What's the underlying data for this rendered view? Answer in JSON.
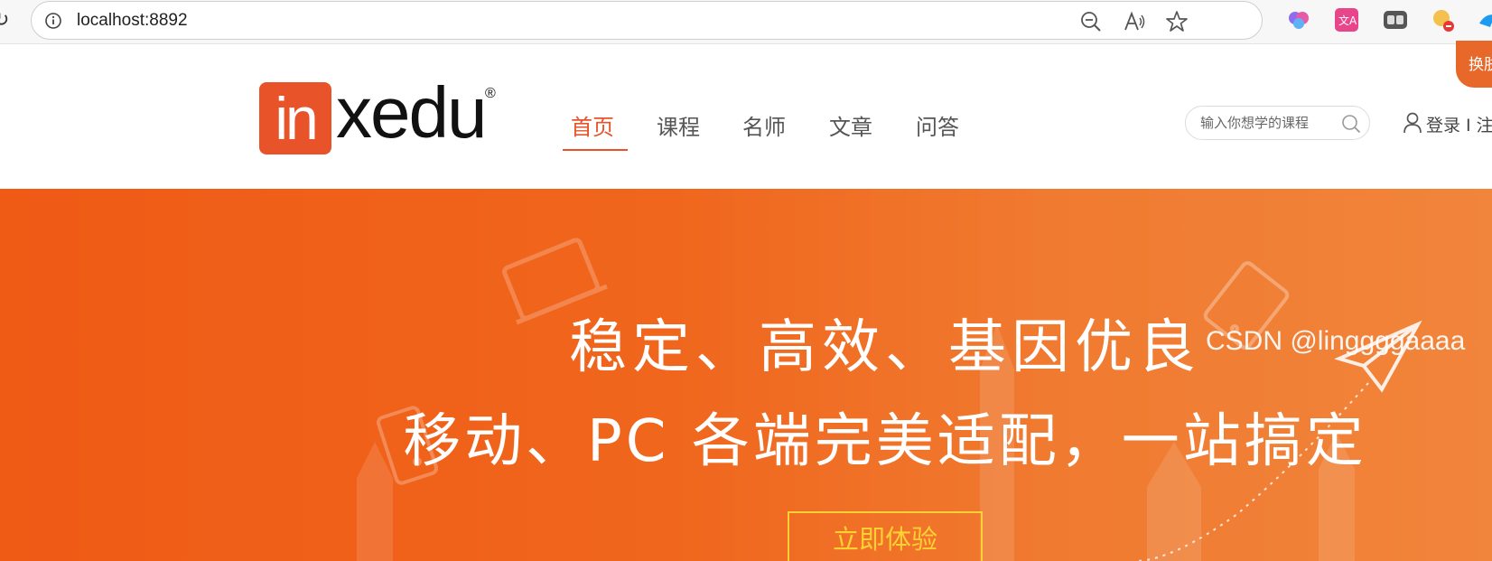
{
  "browser": {
    "url": "localhost:8892"
  },
  "site": {
    "logo": {
      "mark_text": "in",
      "text": "xedu",
      "registered": "®"
    },
    "nav": [
      {
        "label": "首页",
        "active": true
      },
      {
        "label": "课程",
        "active": false
      },
      {
        "label": "名师",
        "active": false
      },
      {
        "label": "文章",
        "active": false
      },
      {
        "label": "问答",
        "active": false
      }
    ],
    "search": {
      "placeholder": "输入你想学的课程"
    },
    "login_label": "登录 I 注",
    "ribbon_label": "换肤"
  },
  "hero": {
    "line1": "稳定、高效、基因优良",
    "line2": "移动、PC 各端完美适配，一站搞定",
    "cta_label": "立即体验"
  },
  "watermark": "CSDN @linggggaaaa",
  "colors": {
    "accent": "#e8532a",
    "hero_bg": "#ef5a15",
    "cta": "#ffd034"
  }
}
